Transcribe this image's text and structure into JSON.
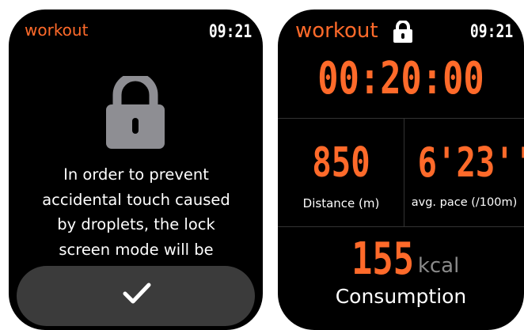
{
  "lock_prompt_screen": {
    "app_title": "workout",
    "time": "09:21",
    "icon": "lock-icon",
    "message_lines": [
      "In order to prevent",
      "accidental touch caused",
      "by droplets, the lock",
      "screen mode will be"
    ],
    "confirm_icon": "checkmark-icon"
  },
  "workout_screen": {
    "app_title": "workout",
    "lock_icon": "lock-icon",
    "time": "09:21",
    "elapsed": "00:20:00",
    "distance": {
      "value": "850",
      "label": "Distance (m)"
    },
    "pace": {
      "value": "6'23''",
      "label": "avg. pace (/100m)"
    },
    "calories": {
      "value": "155",
      "unit": "kcal",
      "label": "Consumption"
    }
  },
  "colors": {
    "accent": "#ff6a2a",
    "background": "#000000",
    "button": "#3b3b3b",
    "icon_gray": "#8e8e93"
  }
}
